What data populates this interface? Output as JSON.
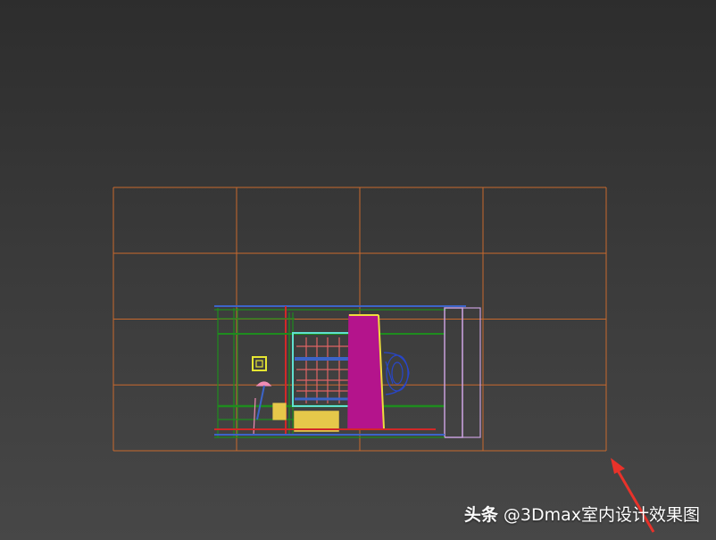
{
  "viewport": {
    "background_top": "#2d2d2d",
    "background_bottom": "#474747",
    "grid_color": "#c8692d",
    "grid_columns": 4,
    "grid_rows": 4
  },
  "scene": {
    "wireframe_colors": {
      "walls": "#1e8c1e",
      "window_frame": "#5fe0d0",
      "window_bars": "#e06464",
      "curtain": "#b4148c",
      "curtain_edge": "#f0dc3c",
      "table": "#e6c84a",
      "chair": "#2846c8",
      "beam": "#3c64c8",
      "red_post": "#d22828",
      "door_frame": "#c8a0dc",
      "lamp": "#f08cb4",
      "frame_icon": "#e6e632"
    }
  },
  "annotation": {
    "arrow_color": "#e8322a",
    "arrow_icon": "red-arrow-icon"
  },
  "watermark": {
    "brand": "头条",
    "handle": "@3Dmax室内设计效果图"
  }
}
